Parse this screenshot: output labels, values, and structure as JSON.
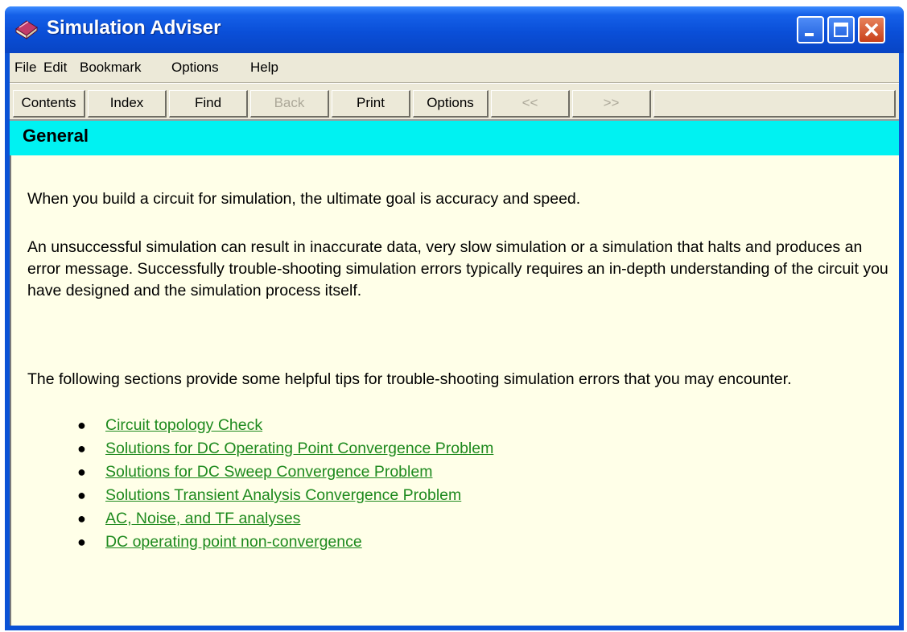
{
  "window": {
    "title": "Simulation Adviser",
    "icon": "book-icon"
  },
  "title_buttons": {
    "minimize": "minimize-icon",
    "maximize": "maximize-icon",
    "close": "close-icon"
  },
  "menu": {
    "items": [
      "File",
      "Edit",
      "Bookmark",
      "Options",
      "Help"
    ]
  },
  "toolbar": {
    "contents": "Contents",
    "index": "Index",
    "find": "Find",
    "back": "Back",
    "print": "Print",
    "options": "Options",
    "prev": "<<",
    "next": ">>"
  },
  "page": {
    "heading": "General",
    "paragraphs": [
      "When you build a circuit for simulation, the ultimate goal is accuracy and speed.",
      "An unsuccessful simulation can result in inaccurate data, very slow simulation or a simulation that halts and produces an error message. Successfully trouble-shooting simulation errors typically requires an in-depth understanding of the circuit you have designed and the simulation process itself.",
      "The following sections provide some helpful tips for trouble-shooting simulation errors that you may encounter."
    ],
    "links": [
      "Circuit topology Check",
      "Solutions for DC Operating Point Convergence Problem",
      "Solutions for DC Sweep Convergence Problem",
      "Solutions Transient Analysis Convergence Problem",
      "AC, Noise, and TF analyses",
      "DC operating point non-convergence"
    ]
  },
  "colors": {
    "title_bar": "#0a4fd8",
    "header_band": "#00f2f2",
    "content_bg": "#ffffe8",
    "link": "#1e8a1e"
  }
}
